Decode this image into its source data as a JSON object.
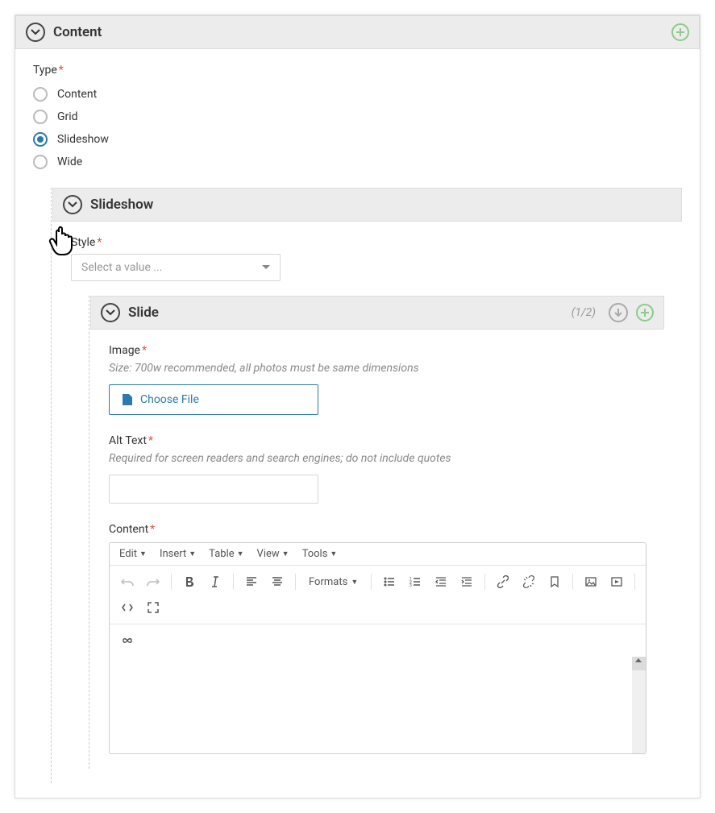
{
  "content_panel": {
    "title": "Content"
  },
  "type_field": {
    "label": "Type",
    "options": [
      "Content",
      "Grid",
      "Slideshow",
      "Wide"
    ],
    "selected_index": 2
  },
  "slideshow_panel": {
    "title": "Slideshow"
  },
  "style_field": {
    "label": "Style",
    "placeholder": "Select a value ..."
  },
  "slide_panel": {
    "title": "Slide",
    "counter": "(1/2)"
  },
  "image_field": {
    "label": "Image",
    "help": "Size: 700w recommended, all photos must be same dimensions",
    "button": "Choose File"
  },
  "alt_field": {
    "label": "Alt Text",
    "help": "Required for screen readers and search engines; do not include quotes",
    "value": ""
  },
  "content_field": {
    "label": "Content"
  },
  "editor": {
    "menus": [
      "Edit",
      "Insert",
      "Table",
      "View",
      "Tools"
    ],
    "formats_label": "Formats"
  }
}
